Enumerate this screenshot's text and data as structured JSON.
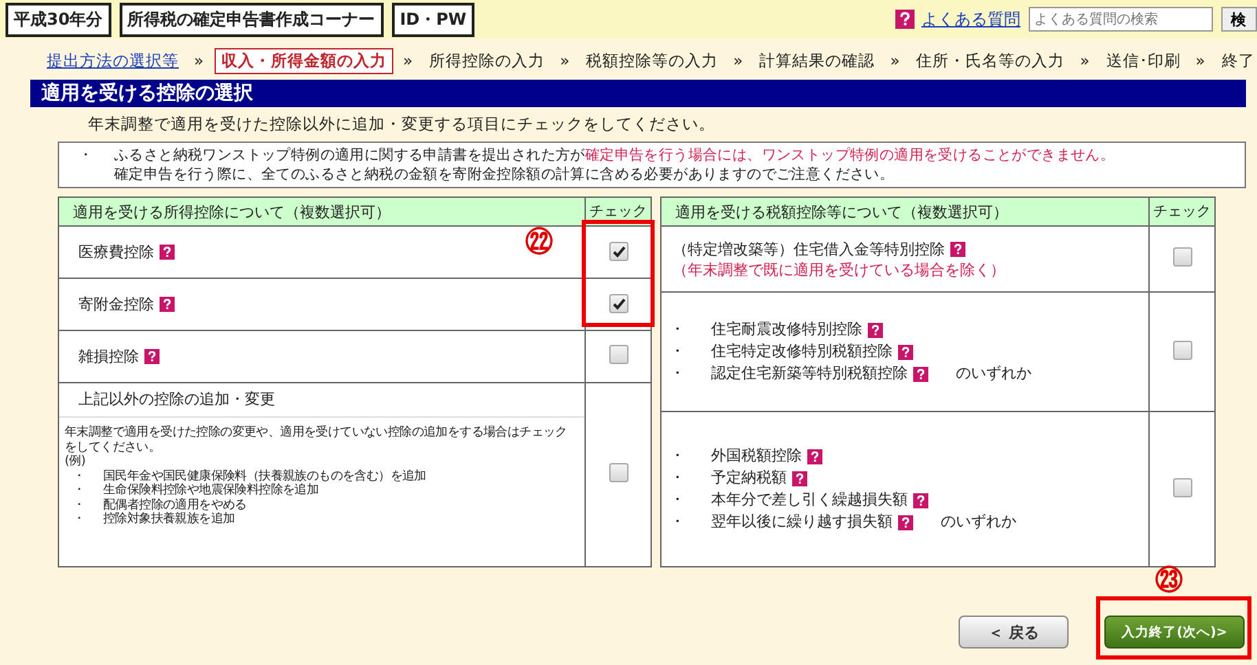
{
  "header": {
    "tags": [
      "平成30年分",
      "所得税の確定申告書作成コーナー",
      "ID・PW"
    ],
    "faq_link": "よくある質問",
    "search": {
      "placeholder": "よくある質問の検索",
      "button": "検"
    }
  },
  "steps": [
    {
      "label": "提出方法の選択等",
      "kind": "link",
      "selected": false,
      "separator": "»"
    },
    {
      "label": "収入・所得金額の入力",
      "kind": "plain",
      "selected": true,
      "separator": "»"
    },
    {
      "label": "所得控除の入力",
      "kind": "plain",
      "selected": false,
      "separator": "»"
    },
    {
      "label": "税額控除等の入力",
      "kind": "plain",
      "selected": false,
      "separator": "»"
    },
    {
      "label": "計算結果の確認",
      "kind": "plain",
      "selected": false,
      "separator": "»"
    },
    {
      "label": "住所・氏名等の入力",
      "kind": "plain",
      "selected": false,
      "separator": "»"
    },
    {
      "label": "送信･印刷",
      "kind": "plain",
      "selected": false,
      "separator": "»"
    },
    {
      "label": "終了",
      "kind": "plain",
      "selected": false
    }
  ],
  "page_title": "適用を受ける控除の選択",
  "instruction": "年末調整で適用を受けた控除以外に追加・変更する項目にチェックをしてください。",
  "notice": {
    "bullet": "・",
    "lines": [
      [
        {
          "text": "ふるさと納税ワンストップ特例の適用に関する申請書を提出された方が",
          "kind": "normal"
        },
        {
          "text": "確定申告を行う場合には、ワンストップ特例の適用を受けることができません。",
          "kind": "warning"
        }
      ],
      [
        {
          "text": "確定申告を行う際に、全てのふるさと納税の金額を寄附金控除額の計算に含める必要がありますのでご注意ください。",
          "kind": "normal"
        }
      ]
    ]
  },
  "income_deductions": {
    "columns": [
      "適用を受ける所得控除について（複数選択可）",
      "チェック"
    ],
    "rows": [
      {
        "kind": "item",
        "label": "医療費控除",
        "help": true,
        "checked": true
      },
      {
        "kind": "item",
        "label": "寄附金控除",
        "help": true,
        "checked": true
      },
      {
        "kind": "item",
        "label": "雑損控除",
        "help": true,
        "checked": false
      },
      {
        "kind": "other",
        "label": "上記以外の控除の追加・変更",
        "description": "年末調整で適用を受けた控除の変更や、適用を受けていない控除の追加をする場合はチェックをしてください。",
        "example_label": "(例)",
        "examples": [
          {
            "bullet": "・",
            "text": "国民年金や国民健康保険料（扶養親族のものを含む）を追加"
          },
          {
            "bullet": "・",
            "text": "生命保険料控除や地震保険料控除を追加"
          },
          {
            "bullet": "・",
            "text": "配偶者控除の適用をやめる"
          },
          {
            "bullet": "・",
            "text": "控除対象扶養親族を追加"
          }
        ],
        "checked": false
      }
    ]
  },
  "tax_credits": {
    "columns": [
      "適用を受ける税額控除等について（複数選択可）",
      "チェック"
    ],
    "rows": [
      {
        "kind": "plain",
        "items": [
          {
            "text": "（特定増改築等）住宅借入金等特別控除",
            "help": true
          }
        ],
        "note": "（年末調整で既に適用を受けている場合を除く）",
        "checked": false
      },
      {
        "kind": "bullets",
        "items": [
          {
            "bullet": "・",
            "text": "住宅耐震改修特別控除",
            "help": true
          },
          {
            "bullet": "・",
            "text": "住宅特定改修特別税額控除",
            "help": true
          },
          {
            "bullet": "・",
            "text": "認定住宅新築等特別税額控除",
            "help": true,
            "suffix": "のいずれか"
          }
        ],
        "checked": false
      },
      {
        "kind": "bullets",
        "items": [
          {
            "bullet": "・",
            "text": "外国税額控除",
            "help": true
          },
          {
            "bullet": "・",
            "text": "予定納税額",
            "help": true
          },
          {
            "bullet": "・",
            "text": "本年分で差し引く繰越損失額",
            "help": true
          },
          {
            "bullet": "・",
            "text": "翌年以後に繰り越す損失額",
            "help": true,
            "suffix": "のいずれか"
          }
        ],
        "checked": false
      }
    ]
  },
  "buttons": {
    "back": "＜ 戻る",
    "next": "入力終了(次へ)>"
  },
  "callouts": [
    {
      "label": "㉒"
    },
    {
      "label": "㉓"
    }
  ]
}
